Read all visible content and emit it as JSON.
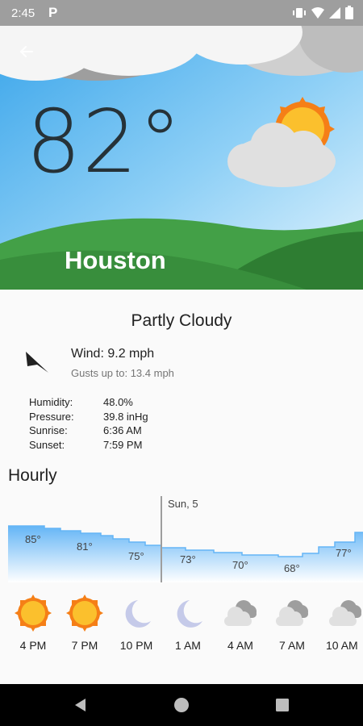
{
  "status_bar": {
    "time": "2:45"
  },
  "weather": {
    "temperature": "82°",
    "city": "Houston",
    "condition": "Partly Cloudy",
    "wind": "Wind: 9.2 mph",
    "gusts": "Gusts up to: 13.4 mph"
  },
  "details": [
    {
      "label": "Humidity:",
      "value": "48.0%"
    },
    {
      "label": "Pressure:",
      "value": "39.8 inHg"
    },
    {
      "label": "Sunrise:",
      "value": "6:36 AM"
    },
    {
      "label": "Sunset:",
      "value": "7:59 PM"
    }
  ],
  "hourly": {
    "title": "Hourly",
    "day_label": "Sun, 5",
    "temp_labels": [
      "85°",
      "81°",
      "75°",
      "73°",
      "70°",
      "68°",
      "77°"
    ],
    "hours": [
      {
        "time": "4 PM",
        "icon": "sun-icon"
      },
      {
        "time": "7 PM",
        "icon": "sun-icon"
      },
      {
        "time": "10 PM",
        "icon": "moon-icon"
      },
      {
        "time": "1 AM",
        "icon": "moon-icon"
      },
      {
        "time": "4 AM",
        "icon": "cloudy-icon"
      },
      {
        "time": "7 AM",
        "icon": "cloudy-icon"
      },
      {
        "time": "10 AM",
        "icon": "cloudy-icon"
      }
    ]
  },
  "colors": {
    "sky_top": "#56b6f0",
    "sky_bottom": "#cbe9fb",
    "hill_dark": "#2e7d32",
    "hill_light": "#43a047",
    "sun": "#fbc02d",
    "sun_ring": "#f57f17"
  }
}
